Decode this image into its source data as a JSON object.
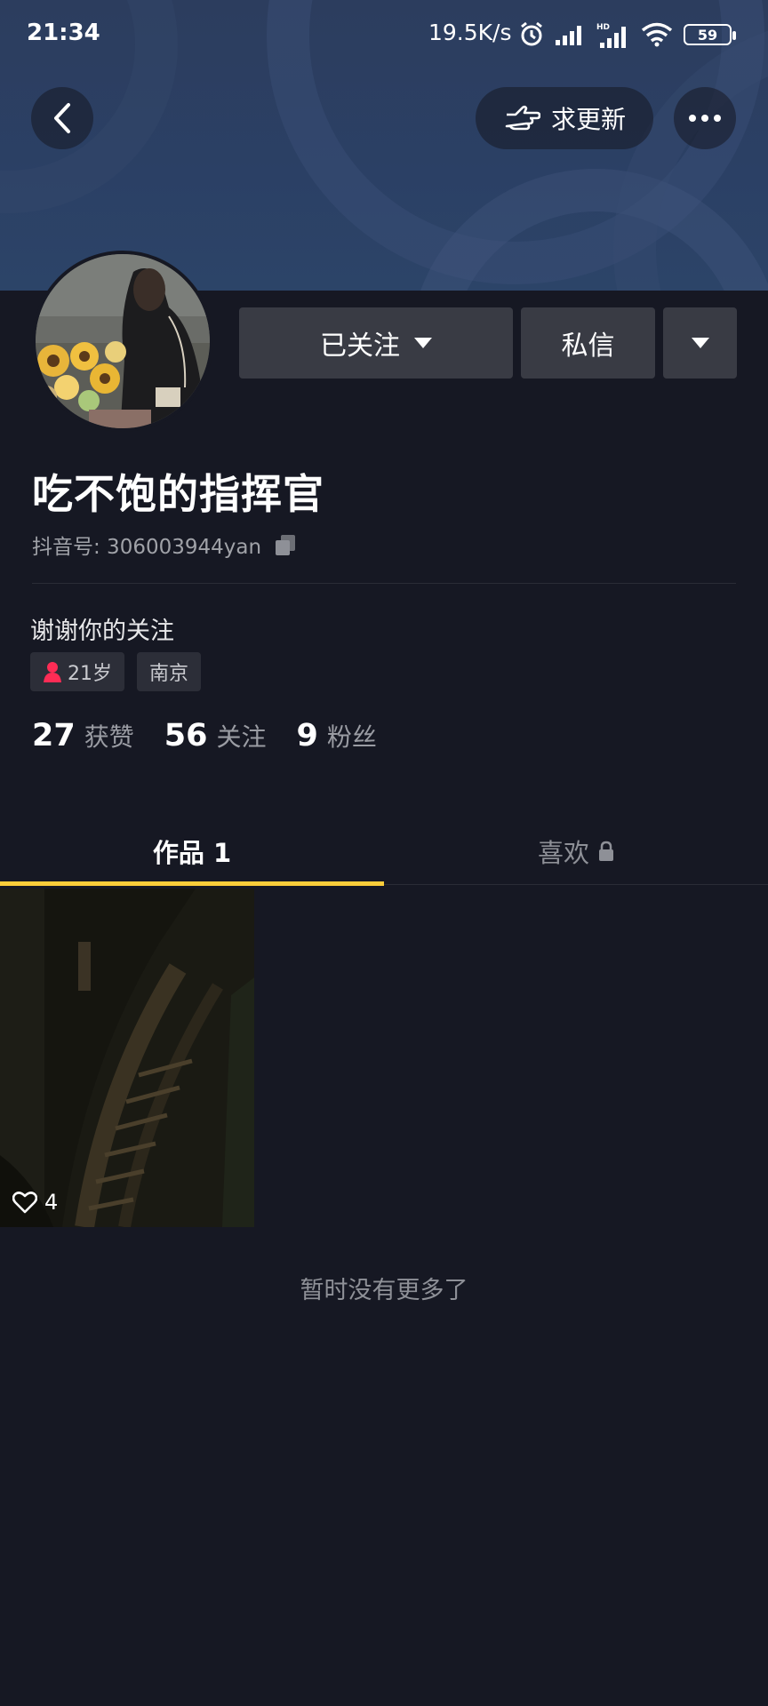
{
  "status_bar": {
    "time": "21:34",
    "net_speed": "19.5K/s",
    "battery": "59",
    "icons": [
      "alarm-icon",
      "signal-icon",
      "hd-signal-icon",
      "wifi-icon",
      "battery-icon"
    ]
  },
  "header": {
    "back_icon": "chevron-left-icon",
    "update_label": "求更新",
    "update_icon": "pointing-hand-icon",
    "more_icon": "more-dots-icon"
  },
  "actions": {
    "followed_label": "已关注",
    "message_label": "私信"
  },
  "profile": {
    "username": "吃不饱的指挥官",
    "douyin_id": "抖音号: 306003944yan",
    "bio": "谢谢你的关注",
    "tags": [
      {
        "icon": "female-icon",
        "label": "21岁"
      },
      {
        "label": "南京"
      }
    ],
    "stats": [
      {
        "num": "27",
        "label": "获赞"
      },
      {
        "num": "56",
        "label": "关注"
      },
      {
        "num": "9",
        "label": "粉丝"
      }
    ]
  },
  "tabs": [
    {
      "label": "作品 1",
      "active": true
    },
    {
      "label": "喜欢",
      "icon": "lock-icon",
      "active": false
    }
  ],
  "videos": [
    {
      "likes": "4"
    }
  ],
  "footer": {
    "no_more": "暂时没有更多了"
  },
  "colors": {
    "background": "#161823",
    "accent": "#facd3a",
    "button": "#393b44",
    "tag_icon": "#fe2c55"
  }
}
